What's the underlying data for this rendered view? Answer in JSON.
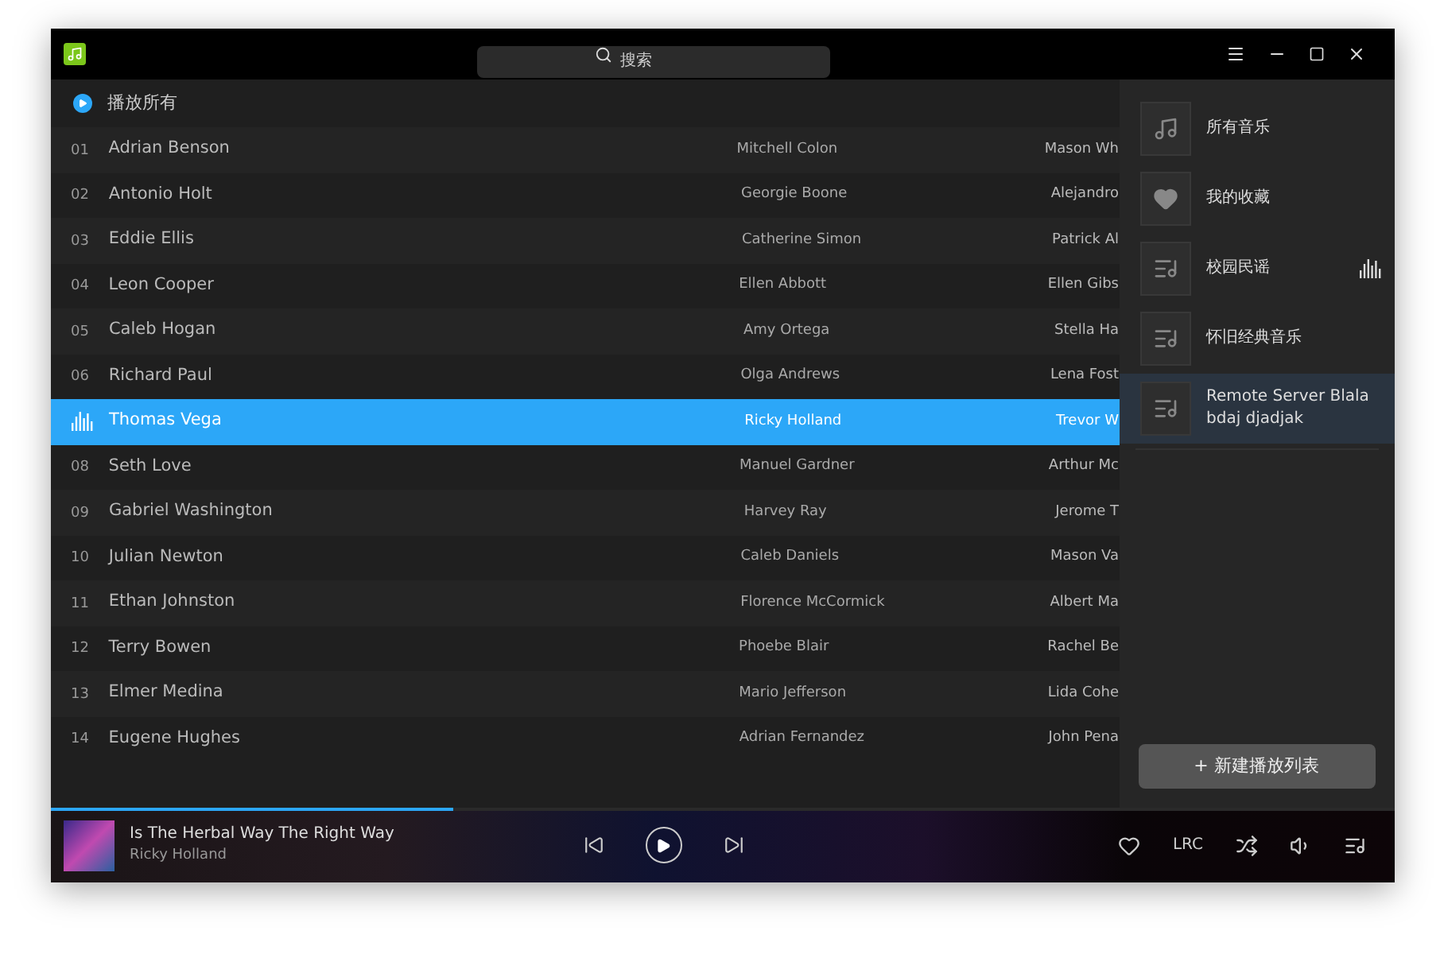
{
  "window": {
    "search_placeholder": "搜索"
  },
  "list_header": {
    "play_all": "播放所有"
  },
  "songs": [
    {
      "number": "01",
      "title": "Adrian Benson",
      "artist": "Mitchell Colon",
      "album": "Mason Wh",
      "selected": false
    },
    {
      "number": "02",
      "title": "Antonio Holt",
      "artist": "Georgie Boone",
      "album": "Alejandro",
      "selected": false
    },
    {
      "number": "03",
      "title": "Eddie Ellis",
      "artist": "Catherine Simon",
      "album": "Patrick Al",
      "selected": false
    },
    {
      "number": "04",
      "title": "Leon Cooper",
      "artist": "Ellen Abbott",
      "album": "Ellen Gibs",
      "selected": false
    },
    {
      "number": "05",
      "title": "Caleb Hogan",
      "artist": "Amy Ortega",
      "album": "Stella Ha",
      "selected": false
    },
    {
      "number": "06",
      "title": "Richard Paul",
      "artist": "Olga Andrews",
      "album": "Lena Fost",
      "selected": false
    },
    {
      "title": "Thomas Vega",
      "artist": "Ricky Holland",
      "album": "Trevor W",
      "selected": true
    },
    {
      "number": "08",
      "title": "Seth Love",
      "artist": "Manuel Gardner",
      "album": "Arthur Mc",
      "selected": false
    },
    {
      "number": "09",
      "title": "Gabriel Washington",
      "artist": "Harvey Ray",
      "album": "Jerome T",
      "selected": false
    },
    {
      "number": "10",
      "title": "Julian Newton",
      "artist": "Caleb Daniels",
      "album": "Mason Va",
      "selected": false
    },
    {
      "number": "11",
      "title": "Ethan Johnston",
      "artist": "Florence McCormick",
      "album": "Albert Ma",
      "selected": false
    },
    {
      "number": "12",
      "title": "Terry Bowen",
      "artist": "Phoebe Blair",
      "album": "Rachel Be",
      "selected": false
    },
    {
      "number": "13",
      "title": "Elmer Medina",
      "artist": "Mario Jefferson",
      "album": "Lida Cohe",
      "selected": false
    },
    {
      "number": "14",
      "title": "Eugene Hughes",
      "artist": "Adrian Fernandez",
      "album": "John Pena",
      "selected": false
    }
  ],
  "playlists": [
    {
      "kind": "music",
      "name": "所有音乐",
      "selected": false,
      "playing": false
    },
    {
      "kind": "favorite",
      "name": "我的收藏",
      "selected": false,
      "playing": false
    },
    {
      "kind": "list",
      "name": "校园民谣",
      "selected": false,
      "playing": true
    },
    {
      "kind": "list",
      "name": "怀旧经典音乐",
      "selected": false,
      "playing": false
    },
    {
      "kind": "list",
      "name": "Remote Server Blala bdaj djadjak",
      "selected": true,
      "playing": false
    }
  ],
  "new_playlist_button": "+ 新建播放列表",
  "player": {
    "title": "Is The Herbal Way The Right Way",
    "artist": "Ricky Holland",
    "level": 0.3,
    "lyrics_button": "LRC"
  }
}
